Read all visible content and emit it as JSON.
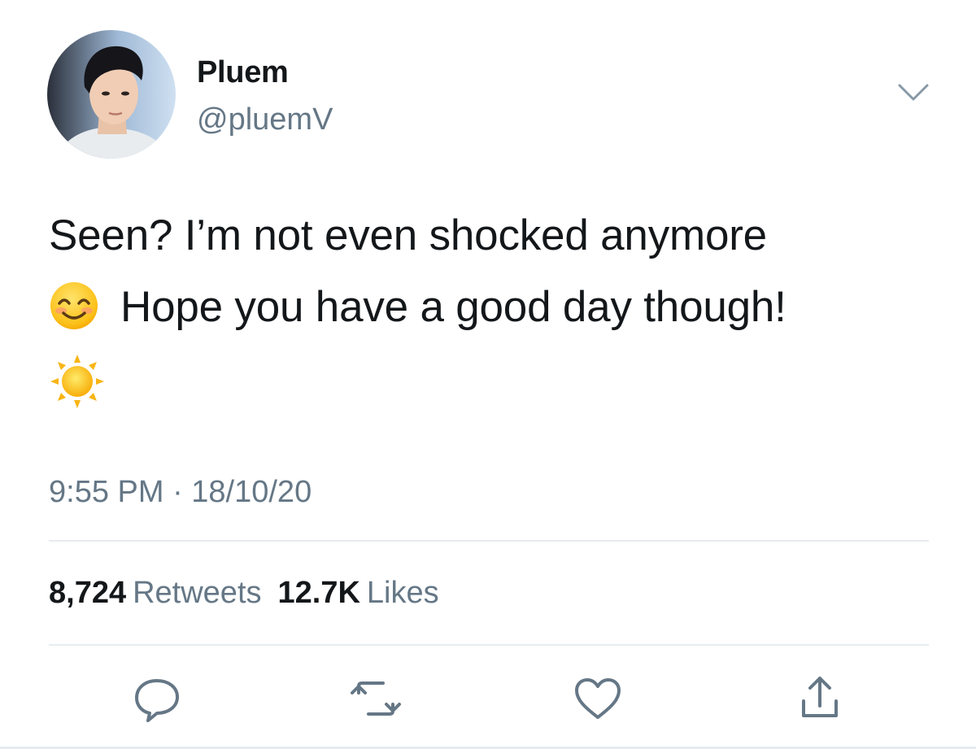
{
  "author": {
    "display_name": "Pluem",
    "handle": "@pluemV",
    "avatar": "profile-photo"
  },
  "tweet": {
    "line1": "Seen? I’m not even shocked anymore",
    "line2": "Hope you have a good day though!",
    "emoji_inline": "smiling-face-emoji",
    "emoji_trailing": "sun-emoji",
    "timestamp": "9:55 PM · 18/10/20"
  },
  "stats": {
    "retweets_count": "8,724",
    "retweets_label": "Retweets",
    "likes_count": "12.7K",
    "likes_label": "Likes"
  },
  "actions": [
    "reply-icon",
    "retweet-icon",
    "like-icon",
    "share-icon"
  ],
  "colors": {
    "text_primary": "#14171a",
    "text_secondary": "#657786",
    "divider": "#e6ecf0",
    "icon": "#657786"
  }
}
